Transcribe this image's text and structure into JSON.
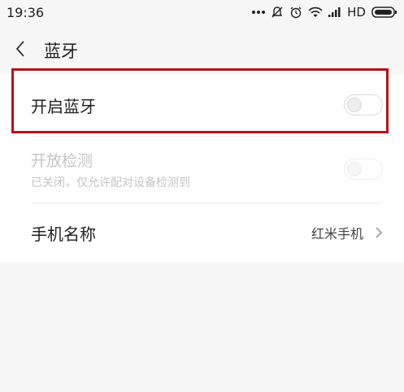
{
  "status_bar": {
    "time": "19:36",
    "icons": [
      "more-dots-icon",
      "alarm-silent-icon",
      "alarm-clock-icon",
      "wifi-icon",
      "signal-icon",
      "hd-label",
      "battery-icon"
    ],
    "hd": "HD"
  },
  "header": {
    "title": "蓝牙",
    "back_icon": "back-chevron-icon"
  },
  "settings": {
    "bluetooth": {
      "label": "开启蓝牙",
      "enabled": false
    },
    "discoverable": {
      "label": "开放检测",
      "subtitle": "已关闭，仅允许配对设备检测到",
      "enabled": false,
      "disabled": true
    },
    "device_name": {
      "label": "手机名称",
      "value": "红米手机"
    }
  },
  "colors": {
    "highlight": "#b5121b",
    "background": "#f7f7f7",
    "disabled_text": "#c4c4c4"
  }
}
